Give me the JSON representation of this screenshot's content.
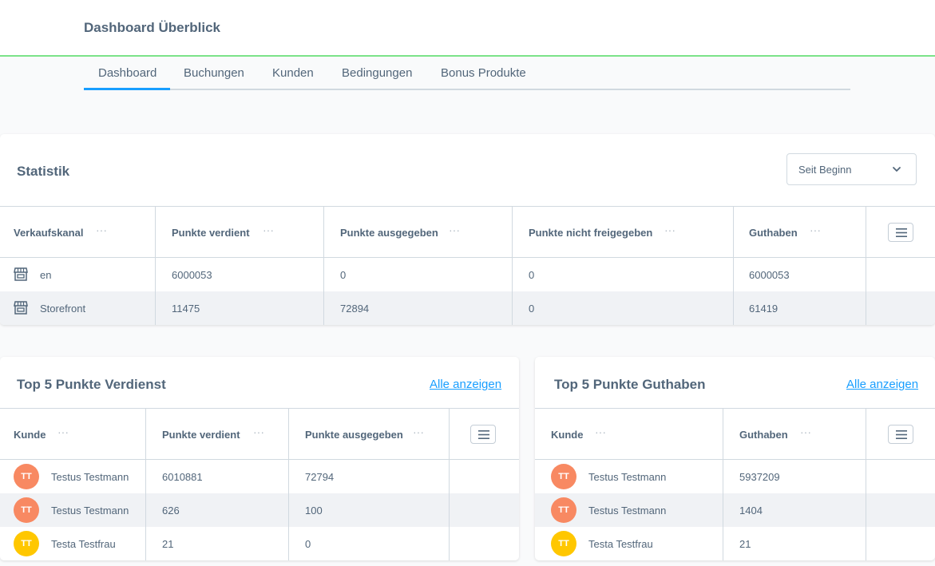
{
  "header": {
    "title": "Dashboard Überblick"
  },
  "tabs": [
    {
      "label": "Dashboard",
      "active": true
    },
    {
      "label": "Buchungen"
    },
    {
      "label": "Kunden"
    },
    {
      "label": "Bedingungen"
    },
    {
      "label": "Bonus Produkte"
    }
  ],
  "statistik": {
    "title": "Statistik",
    "filter": {
      "value": "Seit Beginn"
    },
    "columns": [
      "Verkaufskanal",
      "Punkte verdient",
      "Punkte ausgegeben",
      "Punkte nicht freigegeben",
      "Guthaben"
    ],
    "rows": [
      {
        "kanal": "en",
        "verdient": "6000053",
        "ausgegeben": "0",
        "nicht_freigegeben": "0",
        "guthaben": "6000053"
      },
      {
        "kanal": "Storefront",
        "verdient": "11475",
        "ausgegeben": "72894",
        "nicht_freigegeben": "0",
        "guthaben": "61419"
      }
    ]
  },
  "top_verdienst": {
    "title": "Top 5 Punkte Verdienst",
    "link": "Alle anzeigen",
    "columns": [
      "Kunde",
      "Punkte verdient",
      "Punkte ausgegeben"
    ],
    "rows": [
      {
        "initials": "TT",
        "name": "Testus Testmann",
        "verdient": "6010881",
        "ausgegeben": "72794",
        "avatar_color": "#f88962"
      },
      {
        "initials": "TT",
        "name": "Testus Testmann",
        "verdient": "626",
        "ausgegeben": "100",
        "avatar_color": "#f88962"
      },
      {
        "initials": "TT",
        "name": "Testa Testfrau",
        "verdient": "21",
        "ausgegeben": "0",
        "avatar_color": "#ffc700"
      }
    ]
  },
  "top_guthaben": {
    "title": "Top 5 Punkte Guthaben",
    "link": "Alle anzeigen",
    "columns": [
      "Kunde",
      "Guthaben"
    ],
    "rows": [
      {
        "initials": "TT",
        "name": "Testus Testmann",
        "guthaben": "5937209",
        "avatar_color": "#f88962"
      },
      {
        "initials": "TT",
        "name": "Testus Testmann",
        "guthaben": "1404",
        "avatar_color": "#f88962"
      },
      {
        "initials": "TT",
        "name": "Testa Testfrau",
        "guthaben": "21",
        "avatar_color": "#ffc700"
      }
    ]
  },
  "colors": {
    "accent": "#189eff",
    "header_border": "#7be389",
    "text": "#52667a"
  },
  "icons": {
    "store": "storefront-icon",
    "menu": "hamburger-menu-icon",
    "chevron": "chevron-down-icon",
    "more": "more-dots-icon"
  }
}
